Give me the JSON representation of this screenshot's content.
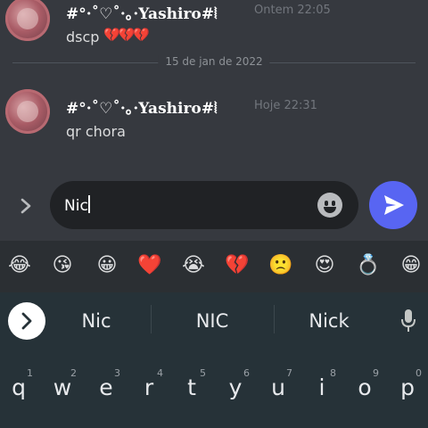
{
  "messages": [
    {
      "username": "#°·˚♡˚·｡·Yashiro#⦚",
      "timestamp": "Ontem 22:05",
      "text": "dscp",
      "emoji": "💔💔💔"
    },
    {
      "username": "#°·˚♡˚·｡·Yashiro#⦚",
      "timestamp": "Hoje 22:31",
      "text": "qr chora"
    }
  ],
  "date_divider": "15 de jan de 2022",
  "composer": {
    "value": "Nic"
  },
  "emoji_suggestions": [
    "😂",
    "😘",
    "😀",
    "❤️",
    "😭",
    "💔",
    "🙁",
    "😍",
    "💍",
    "😁"
  ],
  "word_suggestions": [
    "Nic",
    "NIC",
    "Nick"
  ],
  "keyboard_row": [
    {
      "letter": "q",
      "num": "1"
    },
    {
      "letter": "w",
      "num": "2"
    },
    {
      "letter": "e",
      "num": "3"
    },
    {
      "letter": "r",
      "num": "4"
    },
    {
      "letter": "t",
      "num": "5"
    },
    {
      "letter": "y",
      "num": "6"
    },
    {
      "letter": "u",
      "num": "7"
    },
    {
      "letter": "i",
      "num": "8"
    },
    {
      "letter": "o",
      "num": "9"
    },
    {
      "letter": "p",
      "num": "0"
    }
  ],
  "icons": {
    "expand": "chevron-right-icon",
    "emoji": "smiley-icon",
    "send": "send-arrow-icon",
    "suggestion_toggle": "chevron-right-icon",
    "voice": "microphone-icon"
  },
  "colors": {
    "background": "#36393f",
    "accent": "#5865f2",
    "keyboard": "#263238"
  }
}
